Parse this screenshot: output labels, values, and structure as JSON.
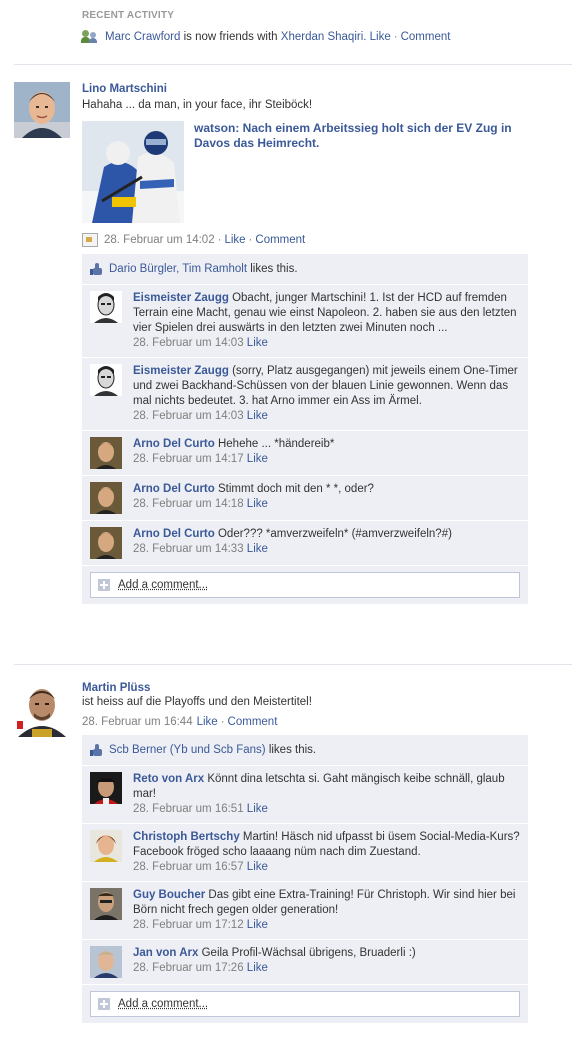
{
  "recent": {
    "heading": "RECENT ACTIVITY",
    "actor": "Marc Crawford",
    "action": "is now friends with",
    "target": "Xherdan Shaqiri.",
    "like": "Like",
    "dot": "·",
    "comment": "Comment"
  },
  "story1": {
    "author": "Lino Martschini",
    "message": "Hahaha ... da man, in your face, ihr Steiböck!",
    "attachment_title": "watson: Nach einem Arbeitssieg holt sich der EV Zug in Davos das Heimrecht.",
    "time": "28. Februar um 14:02",
    "like": "Like",
    "comment": "Comment",
    "likers": "Dario Bürgler, Tim Ramholt",
    "likes_suffix": "likes this.",
    "comments": [
      {
        "author": "Eismeister Zaugg",
        "text": "Obacht, junger Martschini! 1. Ist der HCD auf fremden Terrain eine Macht, genau wie einst Napoleon. 2. haben sie aus den letzten vier Spielen drei auswärts in den letzten zwei Minuten noch ...",
        "time": "28. Februar um 14:03",
        "like": "Like"
      },
      {
        "author": "Eismeister Zaugg",
        "text": "(sorry, Platz ausgegangen) mit jeweils einem One-Timer und zwei Backhand-Schüssen von der blauen Linie gewonnen. Wenn das mal nichts bedeutet. 3. hat Arno immer ein Ass im Ärmel.",
        "time": "28. Februar um 14:03",
        "like": "Like"
      },
      {
        "author": "Arno Del Curto",
        "text": "Hehehe ... *händereib*",
        "time": "28. Februar um 14:17",
        "like": "Like"
      },
      {
        "author": "Arno Del Curto",
        "text": "Stimmt doch mit den * *, oder?",
        "time": "28. Februar um 14:18",
        "like": "Like"
      },
      {
        "author": "Arno Del Curto",
        "text": "Oder??? *amverzweifeln* (#amverzweifeln?#)",
        "time": "28. Februar um 14:33",
        "like": "Like"
      }
    ],
    "add_comment": "Add a comment..."
  },
  "story2": {
    "author": "Martin Plüss",
    "message": "ist heiss auf die Playoffs und den Meistertitel!",
    "time": "28. Februar um 16:44",
    "like": "Like",
    "comment": "Comment",
    "likers": "Scb Berner (Yb und Scb Fans)",
    "likes_suffix": "likes this.",
    "comments": [
      {
        "author": "Reto von Arx",
        "text": "Könnt dina letschta si. Gaht mängisch keibe schnäll, glaub mar!",
        "time": "28. Februar um 16:51",
        "like": "Like"
      },
      {
        "author": "Christoph Bertschy",
        "text": "Martin! Häsch nid ufpasst bi üsem Social-Media-Kurs? Facebook fröged scho laaaang nüm nach dim Zuestand.",
        "time": "28. Februar um 16:57",
        "like": "Like"
      },
      {
        "author": "Guy Boucher",
        "text": "Das gibt eine Extra-Training! Für Christoph. Wir sind hier bei Börn nicht frech gegen older generation!",
        "time": "28. Februar um 17:12",
        "like": "Like"
      },
      {
        "author": "Jan von Arx",
        "text": "Geila Profil-Wächsal übrigens, Bruaderli :)",
        "time": "28. Februar um 17:26",
        "like": "Like"
      }
    ],
    "add_comment": "Add a comment..."
  }
}
